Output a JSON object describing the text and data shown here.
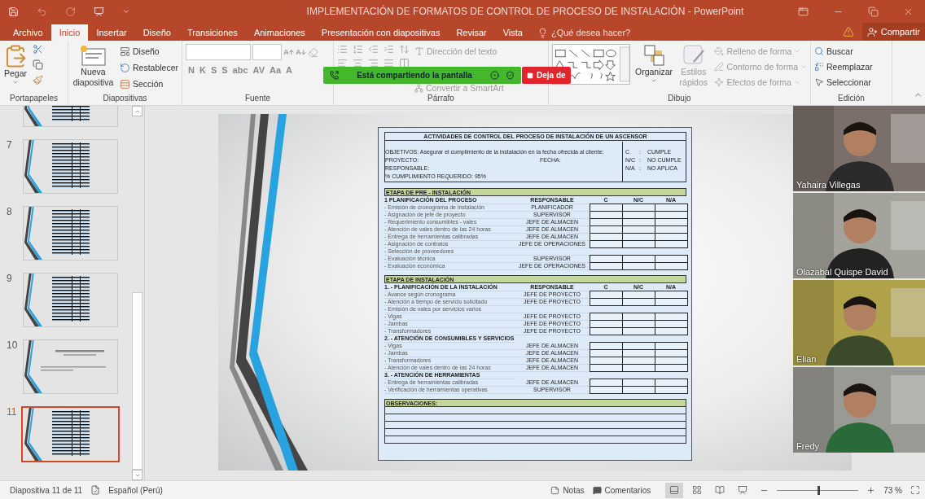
{
  "window": {
    "title": "IMPLEMENTACIÓN DE FORMATOS DE CONTROL DE PROCESO DE INSTALACIÓN - PowerPoint"
  },
  "tabs": [
    {
      "label": "Archivo",
      "selected": false
    },
    {
      "label": "Inicio",
      "selected": true
    },
    {
      "label": "Insertar",
      "selected": false
    },
    {
      "label": "Diseño",
      "selected": false
    },
    {
      "label": "Transiciones",
      "selected": false
    },
    {
      "label": "Animaciones",
      "selected": false
    },
    {
      "label": "Presentación con diapositivas",
      "selected": false
    },
    {
      "label": "Revisar",
      "selected": false
    },
    {
      "label": "Vista",
      "selected": false
    }
  ],
  "tell_me": "¿Qué desea hacer?",
  "share": "Compartir",
  "ribbon": {
    "clipboard": {
      "label": "Portapapeles",
      "paste": "Pegar"
    },
    "slides": {
      "label": "Diapositivas",
      "new_slide": "Nueva diapositiva",
      "commands": [
        "Diseño",
        "Restablecer",
        "Sección"
      ]
    },
    "font": {
      "label": "Fuente",
      "format_buttons": [
        "N",
        "K",
        "S",
        "S",
        "abc",
        "AV",
        "Aa",
        "A"
      ]
    },
    "paragraph": {
      "label": "Párrafo",
      "commands": [
        "Dirección del texto",
        "Convertir a SmartArt"
      ]
    },
    "drawing": {
      "label": "Dibujo",
      "arrange": "Organizar",
      "quick_styles": "Estilos rápidos",
      "commands": [
        "Relleno de forma",
        "Contorno de forma",
        "Efectos de forma"
      ]
    },
    "editing": {
      "label": "Edición",
      "commands": [
        "Buscar",
        "Reemplazar",
        "Seleccionar"
      ]
    }
  },
  "sharing_banner": {
    "text": "Está compartiendo la pantalla",
    "stop": "Deja de"
  },
  "slides": [
    {
      "kind": "table",
      "selected": false
    },
    {
      "number": "7",
      "kind": "table",
      "selected": false
    },
    {
      "number": "8",
      "kind": "table",
      "selected": false
    },
    {
      "number": "9",
      "kind": "table",
      "selected": false
    },
    {
      "number": "10",
      "kind": "title",
      "selected": false
    },
    {
      "number": "11",
      "kind": "table",
      "selected": true
    }
  ],
  "document": {
    "title": "ACTIVIDADES DE CONTROL DEL PROCESO DE INSTALACIÓN DE UN ASCENSOR",
    "objective": "OBJETIVOS: Asegurar el cumplimiento de la instalación en la fecha ofrecida al cliente:",
    "project": "PROYECTO:",
    "date": "FECHA:",
    "responsible": "RESPONSABLE:",
    "compliance": "% CUMPLIMIENTO REQUERIDO: 95%",
    "legend": [
      {
        "code": "C",
        "separator": ":",
        "meaning": "CUMPLE"
      },
      {
        "code": "N/C",
        "separator": ":",
        "meaning": "NO CUMPLE"
      },
      {
        "code": "N/A",
        "separator": ":",
        "meaning": "NO APLICA"
      }
    ],
    "stages": [
      {
        "title": "ETAPA DE PRE - INSTALACIÓN",
        "sections": [
          {
            "title": "1 PLANIFICACIÓN DEL PROCESO",
            "columns": [
              "RESPONSABLE",
              "C",
              "N/C",
              "N/A"
            ],
            "rows": [
              {
                "activity": "- Emisión de cronograma de instalación",
                "responsible": "PLANIFICADOR"
              },
              {
                "activity": "- Asignación de jefe de proyecto",
                "responsible": "SUPERVISOR"
              },
              {
                "activity": "- Requerimiento consumibles - vales",
                "responsible": "JEFE DE ALMACEN"
              },
              {
                "activity": "- Atención de vales dentro de las 24 horas",
                "responsible": "JEFE DE ALMACEN"
              },
              {
                "activity": "- Entrega de herramientas calibradas",
                "responsible": "JEFE DE ALMACEN"
              },
              {
                "activity": "- Asignación de contratos",
                "responsible": "JEFE DE OPERACIONES"
              },
              {
                "activity": "- Selección de proveedores"
              },
              {
                "activity": "- Evaluación técnica",
                "responsible": "SUPERVISOR"
              },
              {
                "activity": "- Evaluación económica",
                "responsible": "JEFE DE OPERACIONES"
              }
            ]
          }
        ]
      },
      {
        "title": "ETAPA DE INSTALACIÓN",
        "sections": [
          {
            "title": "1. - PLANIFICACIÓN DE LA INSTALACIÓN",
            "columns": [
              "RESPONSABLE",
              "C",
              "N/C",
              "N/A"
            ],
            "rows": [
              {
                "activity": "- Avance según cronograma",
                "responsible": "JEFE DE PROYECTO"
              },
              {
                "activity": "- Atención a tiempo de servicio solicitado",
                "responsible": "JEFE DE PROYECTO"
              },
              {
                "activity": "- Emisión de vales por servicios varios"
              },
              {
                "activity": "- Vigas",
                "responsible": "JEFE DE PROYECTO"
              },
              {
                "activity": "- Jambas",
                "responsible": "JEFE DE PROYECTO"
              },
              {
                "activity": "- Transformadores",
                "responsible": "JEFE DE PROYECTO"
              }
            ]
          },
          {
            "title": "2. - ATENCIÓN DE CONSUMIBLES Y SERVICIOS",
            "rows": [
              {
                "activity": "- Vigas",
                "responsible": "JEFE DE ALMACEN"
              },
              {
                "activity": "- Jambas",
                "responsible": "JEFE DE ALMACEN"
              },
              {
                "activity": "- Transformadores",
                "responsible": "JEFE DE ALMACEN"
              },
              {
                "activity": "- Atención de vales dentro de las 24 horas",
                "responsible": "JEFE DE ALMACEN"
              }
            ]
          },
          {
            "title": "3. - ATENCIÓN DE HERRAMIENTAS",
            "rows": [
              {
                "activity": "- Entrega de herramientas calibradas",
                "responsible": "JEFE DE ALMACEN"
              },
              {
                "activity": "- Verificación de herramientas operativas",
                "responsible": "SUPERVISOR"
              }
            ]
          }
        ]
      }
    ],
    "observations": "OBSERVACIONES:"
  },
  "participants": [
    {
      "name": "Yahaira Villegas"
    },
    {
      "name": "Olazabal Quispe David"
    },
    {
      "name": "Elian"
    },
    {
      "name": "Fredy"
    }
  ],
  "status_bar": {
    "slide": "Diapositiva 11 de 11",
    "language": "Español (Perú)",
    "notes": "Notas",
    "comments": "Comentarios",
    "views": [
      {
        "kind": "normal",
        "selected": true
      },
      {
        "kind": "sorter",
        "selected": false
      },
      {
        "kind": "reading",
        "selected": false
      },
      {
        "kind": "show",
        "selected": false
      }
    ],
    "zoom_slider": {
      "level": 0.5
    },
    "zoom": "73 %"
  }
}
